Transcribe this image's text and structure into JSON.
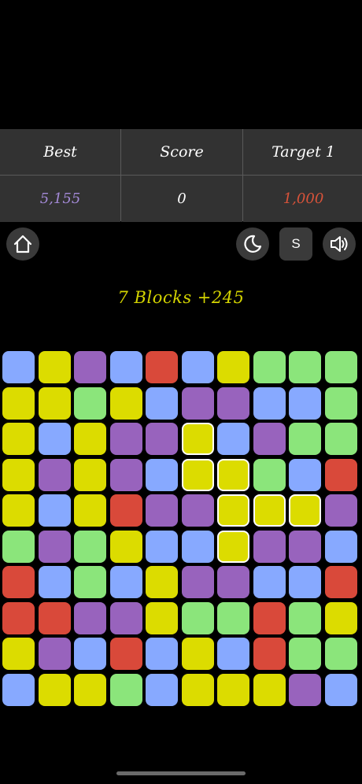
{
  "scoreboard": {
    "best_label": "Best",
    "score_label": "Score",
    "target_label": "Target 1",
    "best_value": "5,155",
    "score_value": "0",
    "target_value": "1,000"
  },
  "controls": {
    "home_icon": "home-icon",
    "theme_icon": "moon-icon",
    "s_label": "S",
    "sound_icon": "speaker-icon"
  },
  "message": "7 Blocks +245",
  "colors": {
    "B": "#87a9ff",
    "Y": "#dcdc00",
    "P": "#9863bd",
    "R": "#d9493a",
    "G": "#8be57b"
  },
  "board": {
    "rows": [
      "BYPBRBYGGG",
      "YYGYBPPBBG",
      "YBYPPYBPGG",
      "YPYPBYYGBR",
      "YBYRPPYYYP",
      "GPGYBBYPPB",
      "RBGBYPPBBR",
      "RRPPYGGRGY",
      "YPBRBYBRGG",
      "BYYGBYYYPB"
    ],
    "selected": [
      [
        2,
        5
      ],
      [
        3,
        5
      ],
      [
        3,
        6
      ],
      [
        4,
        6
      ],
      [
        4,
        7
      ],
      [
        4,
        8
      ],
      [
        5,
        6
      ]
    ]
  }
}
